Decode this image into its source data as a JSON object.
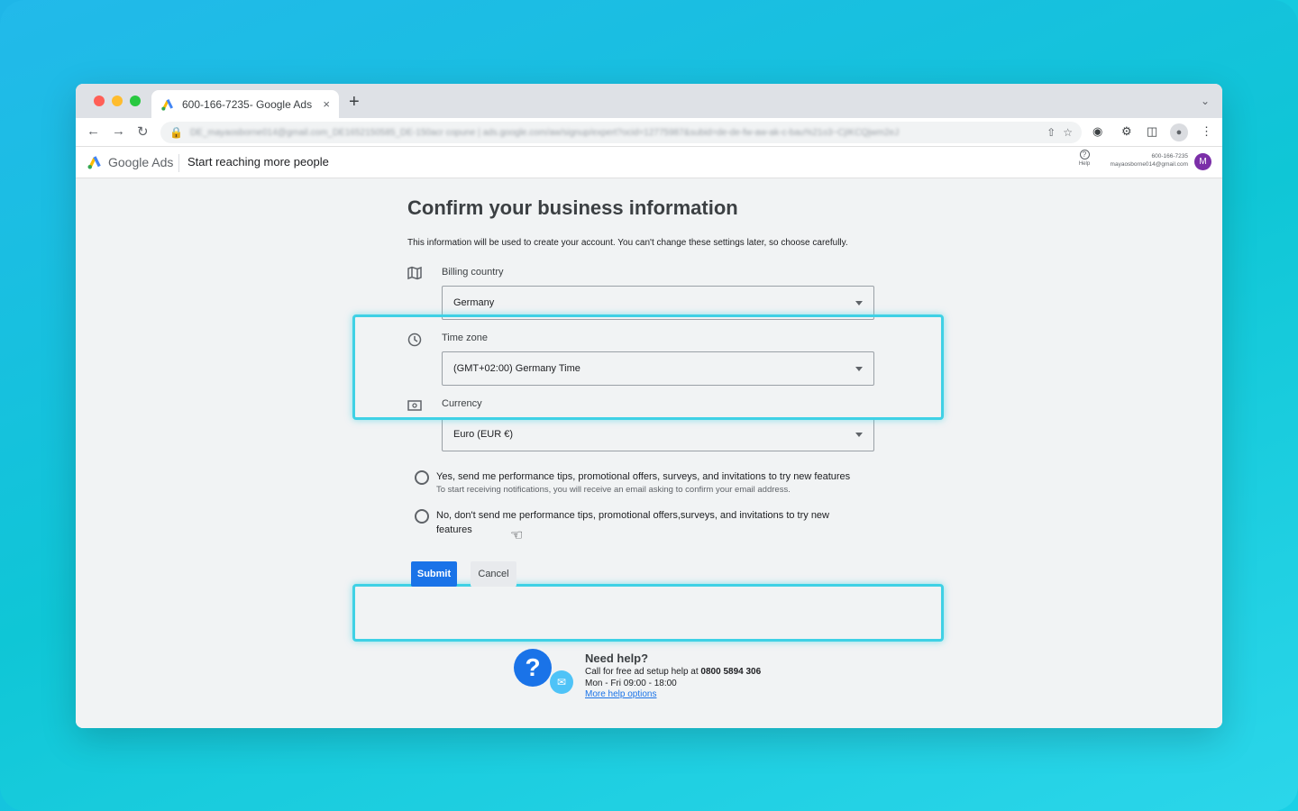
{
  "browser": {
    "tab_title": "600-166-7235- Google Ads",
    "tab_close": "×",
    "new_tab": "+",
    "url": "DE_mayaosborne014@gmail.com_DE1652150585_DE-150acr copune | ads.google.com/aw/signup/expert?ocid=12775987&subid=de-de-fw-aw-ak-c-bau%21o3~CjIKCQjwm2eJ"
  },
  "app_header": {
    "brand": "Google Ads",
    "title": "Start reaching more people",
    "help_label": "Help",
    "account_id": "600-166-7235",
    "account_email": "mayaosborne014@gmail.com",
    "avatar_letter": "M"
  },
  "form": {
    "page_title": "Confirm your business information",
    "intro": "This information will be used to create your account. You can't change these settings later, so choose carefully.",
    "billing_country": {
      "label": "Billing country",
      "value": "Germany"
    },
    "time_zone": {
      "label": "Time zone",
      "value": "(GMT+02:00) Germany Time"
    },
    "currency": {
      "label": "Currency",
      "value": "Euro (EUR €)"
    },
    "opt_in": {
      "label": "Yes, send me performance tips, promotional offers, surveys, and invitations to try new features",
      "note": "To start receiving notifications, you will receive an email asking to confirm your email address."
    },
    "opt_out": {
      "label_line1": "No, don't send me performance tips, promotional offers,surveys, and invitations to try new",
      "label_line2": "features"
    },
    "submit_label": "Submit",
    "cancel_label": "Cancel"
  },
  "help_section": {
    "title": "Need help?",
    "call_prefix": "Call for free ad setup help at",
    "phone": "0800 5894 306",
    "hours": "Mon - Fri 09:00 - 18:00",
    "more_link": "More help options"
  },
  "icons": {
    "back": "back-arrow-icon",
    "forward": "forward-arrow-icon",
    "reload": "reload-icon",
    "lock": "lock-icon",
    "share": "share-icon",
    "bookmark": "star-icon",
    "extension": "puzzle-icon",
    "map": "map-icon",
    "clock": "clock-icon",
    "currency": "currency-icon"
  },
  "colors": {
    "accent": "#1a73e8",
    "highlight": "#3fd1e5",
    "avatar": "#7b2fa8"
  }
}
